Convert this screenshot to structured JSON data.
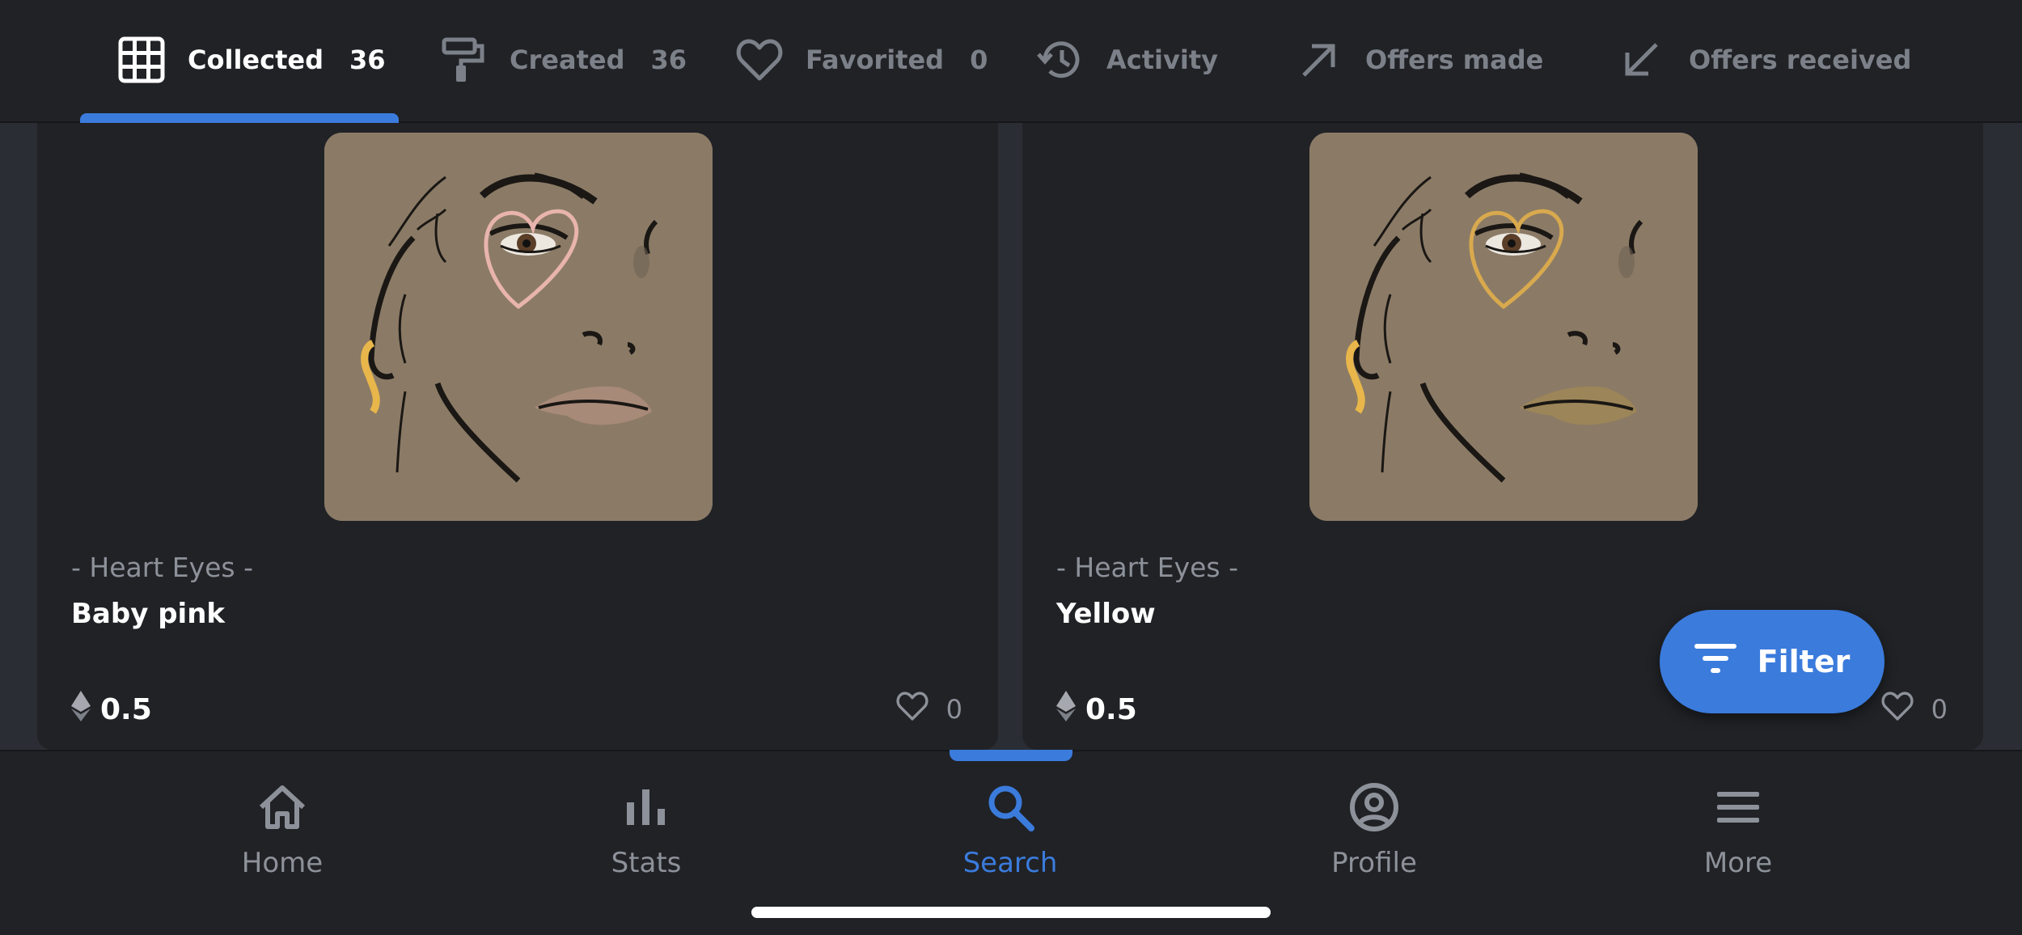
{
  "tabs": [
    {
      "label": "Collected",
      "count": "36",
      "icon": "grid-icon",
      "active": true
    },
    {
      "label": "Created",
      "count": "36",
      "icon": "paint-roller-icon",
      "active": false
    },
    {
      "label": "Favorited",
      "count": "0",
      "icon": "heart-icon",
      "active": false
    },
    {
      "label": "Activity",
      "count": "",
      "icon": "history-icon",
      "active": false
    },
    {
      "label": "Offers made",
      "count": "",
      "icon": "arrow-up-right-icon",
      "active": false
    },
    {
      "label": "Offers received",
      "count": "",
      "icon": "arrow-down-left-icon",
      "active": false
    }
  ],
  "items": [
    {
      "collection": "- Heart Eyes -",
      "name": "Baby pink",
      "price": "0.5",
      "likes": "0",
      "heart_color": "#e8b4ad",
      "lip_color": "#a88a78"
    },
    {
      "collection": "- Heart Eyes -",
      "name": "Yellow",
      "price": "0.5",
      "likes": "0",
      "heart_color": "#d9a94e",
      "lip_color": "#9c8558"
    }
  ],
  "filter": {
    "label": "Filter"
  },
  "nav": [
    {
      "label": "Home",
      "icon": "home-icon",
      "active": false
    },
    {
      "label": "Stats",
      "icon": "bar-chart-icon",
      "active": false
    },
    {
      "label": "Search",
      "icon": "search-icon",
      "active": true
    },
    {
      "label": "Profile",
      "icon": "profile-icon",
      "active": false
    },
    {
      "label": "More",
      "icon": "menu-icon",
      "active": false
    }
  ],
  "colors": {
    "accent": "#3b7bdc",
    "background": "#202226",
    "muted": "#8d9199"
  }
}
